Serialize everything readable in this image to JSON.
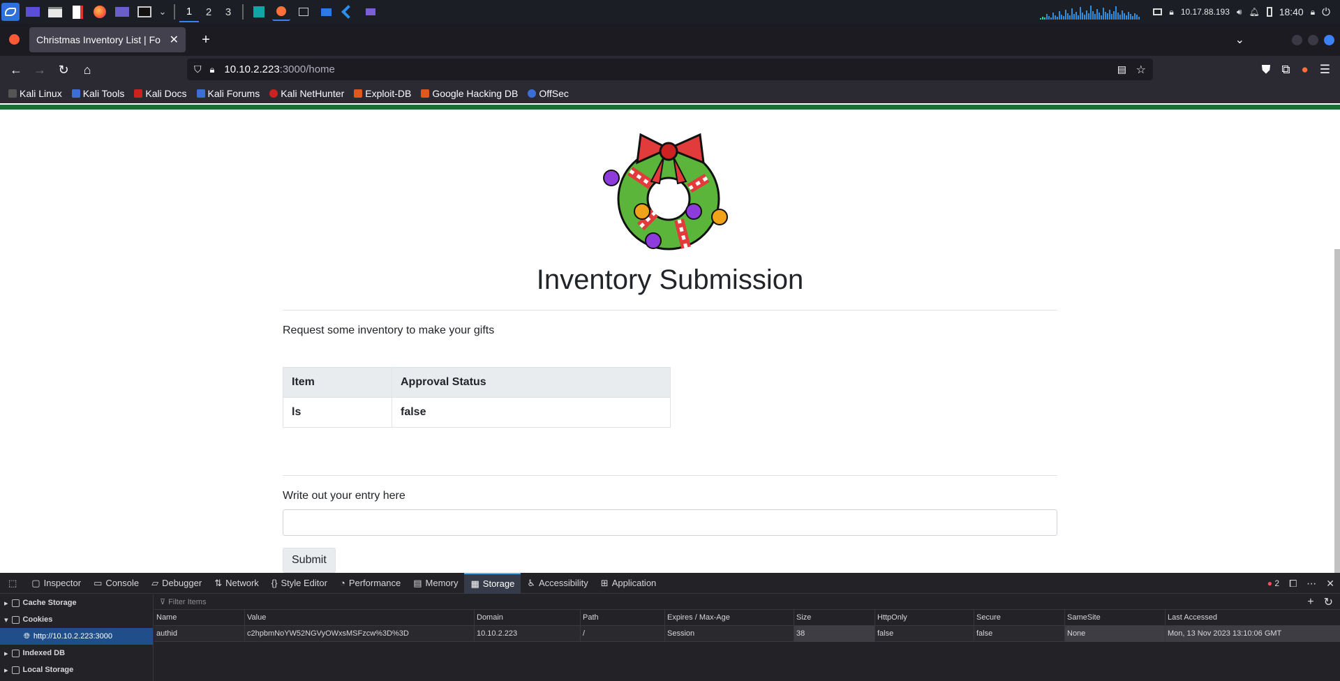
{
  "taskbar": {
    "workspaces": [
      "1",
      "2",
      "3"
    ],
    "ip": "10.17.88.193",
    "time": "18:40"
  },
  "browser": {
    "tab_title": "Christmas Inventory List | Fo",
    "url_host": "10.10.2.223",
    "url_rest": ":3000/home",
    "bookmarks": [
      "Kali Linux",
      "Kali Tools",
      "Kali Docs",
      "Kali Forums",
      "Kali NetHunter",
      "Exploit-DB",
      "Google Hacking DB",
      "OffSec"
    ]
  },
  "page": {
    "title": "Inventory Submission",
    "subtitle": "Request some inventory to make your gifts",
    "table_headers": [
      "Item",
      "Approval Status"
    ],
    "table_row": [
      "ls",
      "false"
    ],
    "entry_label": "Write out your entry here",
    "entry_value": "",
    "submit_label": "Submit"
  },
  "devtools": {
    "tabs": [
      "Inspector",
      "Console",
      "Debugger",
      "Network",
      "Style Editor",
      "Performance",
      "Memory",
      "Storage",
      "Accessibility",
      "Application"
    ],
    "active_tab": "Storage",
    "error_count": "2",
    "sidebar": [
      "Cache Storage",
      "Cookies",
      "http://10.10.2.223:3000",
      "Indexed DB",
      "Local Storage"
    ],
    "filter_placeholder": "Filter Items",
    "columns": [
      "Name",
      "Value",
      "Domain",
      "Path",
      "Expires / Max-Age",
      "Size",
      "HttpOnly",
      "Secure",
      "SameSite",
      "Last Accessed"
    ],
    "cookie_row": [
      "authid",
      "c2hpbmNoYW52NGVyOWxsMSFzcw%3D%3D",
      "10.10.2.223",
      "/",
      "Session",
      "38",
      "false",
      "false",
      "None",
      "Mon, 13 Nov 2023 13:10:06 GMT"
    ]
  }
}
